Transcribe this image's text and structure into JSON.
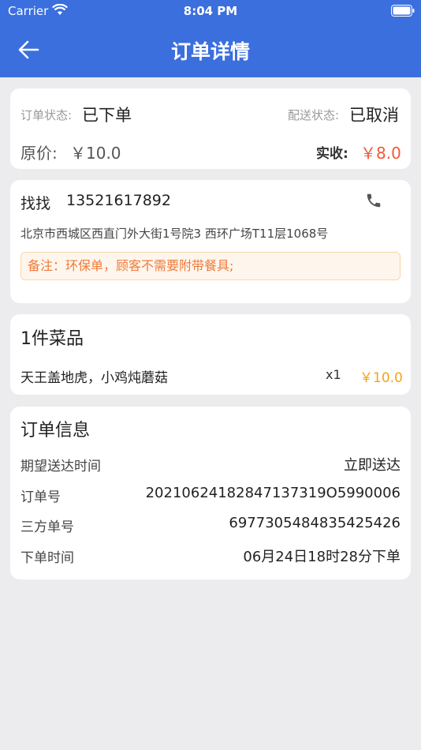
{
  "status_bar": {
    "carrier": "Carrier",
    "time": "8:04 PM"
  },
  "nav": {
    "title": "订单详情"
  },
  "summary": {
    "order_status_label": "订单状态:",
    "order_status_value": "已下单",
    "delivery_status_label": "配送状态:",
    "delivery_status_value": "已取消",
    "original_price_label": "原价:",
    "original_price_value": "￥10.0",
    "actual_label": "实收:",
    "actual_value": "￥8.0"
  },
  "customer": {
    "name": "找找",
    "phone": "13521617892",
    "address": "北京市西城区西直门外大街1号院3 西环广场T11层1068号",
    "note": "备注：环保单，顾客不需要附带餐具;"
  },
  "items": {
    "title": "1件菜品",
    "list": [
      {
        "name": "天王盖地虎，小鸡炖蘑菇",
        "qty": "x1",
        "price": "￥10.0"
      }
    ]
  },
  "order_info": {
    "title": "订单信息",
    "rows": [
      {
        "label": "期望送达时间",
        "value": "立即送达"
      },
      {
        "label": "订单号",
        "value": "20210624182847137319O5990006"
      },
      {
        "label": "三方单号",
        "value": "6977305484835425426"
      },
      {
        "label": "下单时间",
        "value": "06月24日18时28分下单"
      }
    ]
  },
  "colors": {
    "header": "#3b6fde",
    "accent_orange": "#f5a21a",
    "accent_red": "#f05a3a"
  }
}
